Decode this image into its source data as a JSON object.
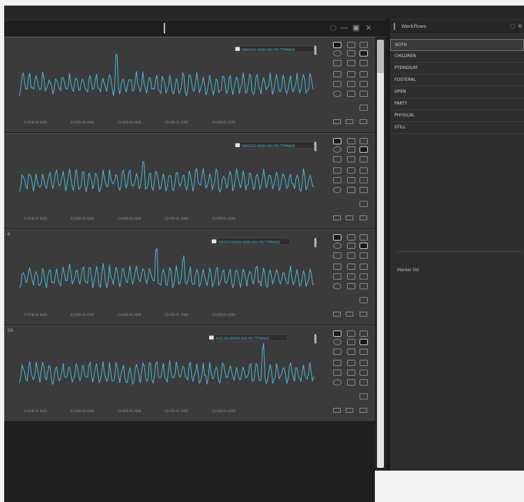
{
  "colors": {
    "series": "#4db6d6",
    "panel": "#3b3b3b",
    "background": "#2b2b2b"
  },
  "right_panel": {
    "title": "Workflows",
    "items": [
      "BOTH",
      "CHILDREN",
      "PTERIDIUM",
      "FOSTERAL",
      "OPEN",
      "PARTY",
      "PHYSICAL",
      "STILL"
    ],
    "selected_index": 0,
    "lower_label": "Marker list"
  },
  "panels": [
    {
      "number": "",
      "legend": "XMGG31-0000-001 PQ.TTPMAD2",
      "x_ticks": [
        "13-FEB-20 2020",
        "13-FEB-20 2020",
        "13-FEB-20 2020",
        "13-FEB-21 2020",
        "13-FEB-21 2020"
      ]
    },
    {
      "number": "",
      "legend": "XMGG31-0000-001 PQ.TTPMAD2",
      "x_ticks": [
        "13-FEB-20 2020",
        "13-FEB-20 2020",
        "13-FEB-20 2020",
        "13-FEB-21 2020",
        "13-FEB-21 2020"
      ]
    },
    {
      "number": "4",
      "legend": "XGGGT-00000-0000-001 PQ.TTPMAD2",
      "x_ticks": [
        "13-FEB-20 2020",
        "13-FEB-20 2020",
        "13-FEB-20 2020",
        "13-FEB-21 2020",
        "13-FEB-21 2020"
      ]
    },
    {
      "number": "36",
      "legend": "XGG-00-00000-001 PQ.TTPMAD2",
      "x_ticks": [
        "13-FEB-20 2020",
        "13-FEB-20 2020",
        "13-FEB-20 2020",
        "13-FEB-21 2020",
        "13-FEB-21 2020"
      ]
    }
  ]
}
